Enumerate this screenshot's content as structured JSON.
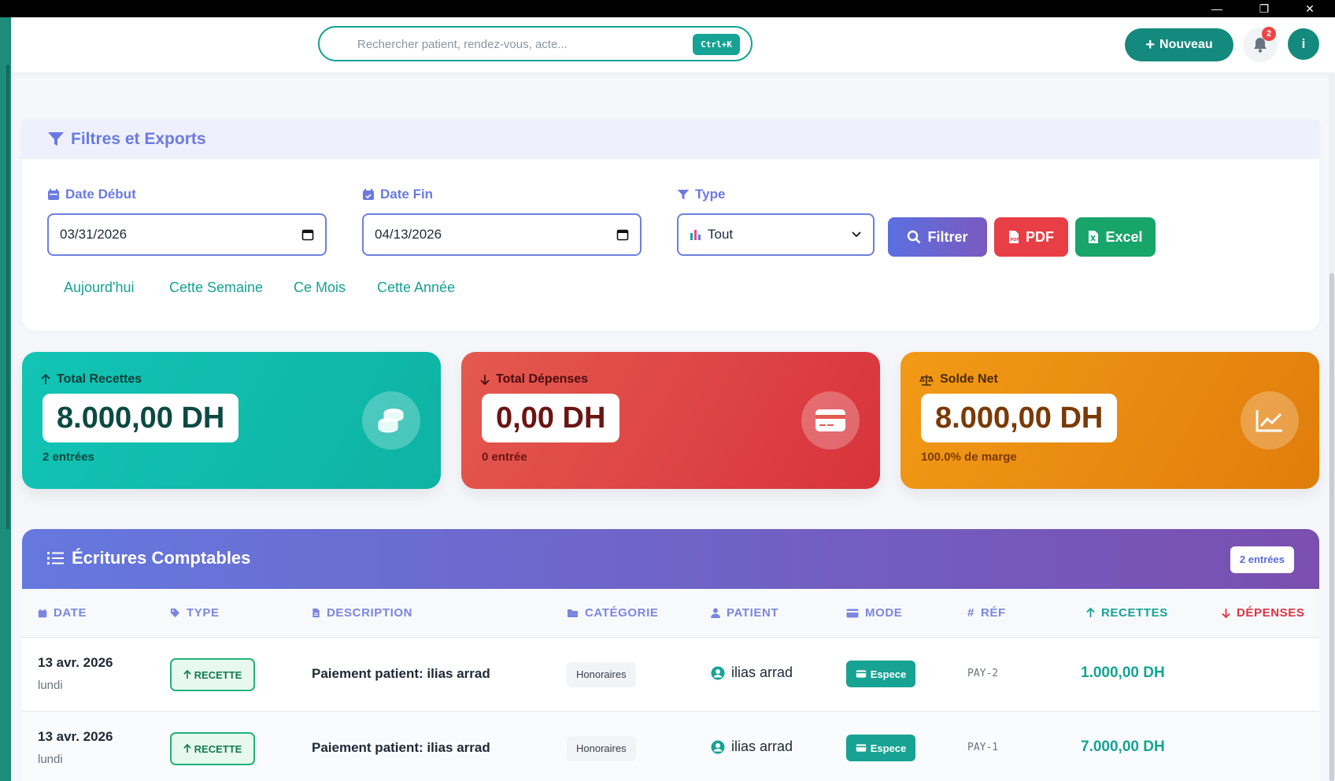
{
  "window": {
    "minimize": "—",
    "restore": "❐",
    "close": "✕"
  },
  "header": {
    "search_placeholder": "Rechercher patient, rendez-vous, acte...",
    "search_shortcut": "Ctrl+K",
    "new_button": "Nouveau",
    "notifications_count": "2",
    "avatar_initial": "i"
  },
  "filters": {
    "title": "Filtres et Exports",
    "date_start_label": "Date Début",
    "date_start_value": "03/31/2026",
    "date_end_label": "Date Fin",
    "date_end_value": "04/13/2026",
    "type_label": "Type",
    "type_value": "Tout",
    "filter_button": "Filtrer",
    "pdf_button": "PDF",
    "excel_button": "Excel",
    "quick_ranges": [
      "Aujourd'hui",
      "Cette Semaine",
      "Ce Mois",
      "Cette Année"
    ]
  },
  "stats": {
    "recettes": {
      "label": "Total Recettes",
      "value": "8.000,00 DH",
      "sub": "2 entrées",
      "color": "#16b8a8"
    },
    "depenses": {
      "label": "Total Dépenses",
      "value": "0,00 DH",
      "sub": "0 entrée",
      "color": "#e0473f"
    },
    "solde": {
      "label": "Solde Net",
      "value": "8.000,00 DH",
      "sub": "100.0% de marge",
      "color": "#ec8d14"
    }
  },
  "entries": {
    "title": "Écritures Comptables",
    "count": "2 entrées",
    "columns": {
      "date": "DATE",
      "type": "TYPE",
      "description": "DESCRIPTION",
      "category": "CATÉGORIE",
      "patient": "PATIENT",
      "mode": "MODE",
      "ref": "RÉF",
      "recettes": "RECETTES",
      "depenses": "DÉPENSES"
    },
    "rows": [
      {
        "date": "13 avr. 2026",
        "day": "lundi",
        "type": "RECETTE",
        "description": "Paiement patient: ilias arrad",
        "category": "Honoraires",
        "patient": "ilias arrad",
        "mode": "Espece",
        "ref": "PAY-2",
        "recette": "1.000,00 DH"
      },
      {
        "date": "13 avr. 2026",
        "day": "lundi",
        "type": "RECETTE",
        "description": "Paiement patient: ilias arrad",
        "category": "Honoraires",
        "patient": "ilias arrad",
        "mode": "Espece",
        "ref": "PAY-1",
        "recette": "7.000,00 DH"
      }
    ]
  }
}
